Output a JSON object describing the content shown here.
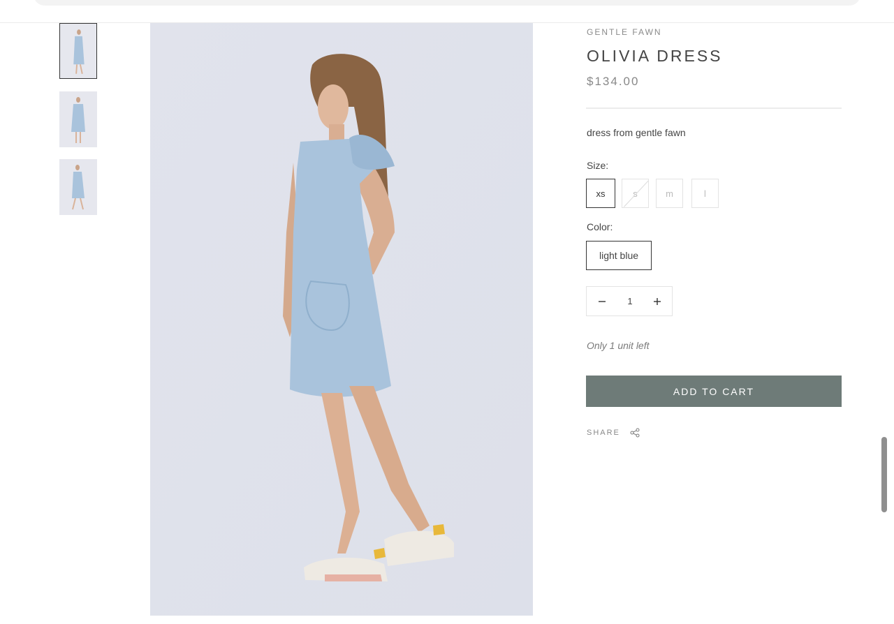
{
  "product": {
    "brand": "GENTLE FAWN",
    "title": "OLIVIA DRESS",
    "price": "$134.00",
    "description": "dress from gentle fawn",
    "size_label": "Size:",
    "sizes": [
      {
        "label": "xs",
        "state": "selected"
      },
      {
        "label": "s",
        "state": "sold-out"
      },
      {
        "label": "m",
        "state": "available"
      },
      {
        "label": "l",
        "state": "available"
      }
    ],
    "color_label": "Color:",
    "color": "light blue",
    "quantity": "1",
    "stock_note": "Only 1 unit left",
    "add_to_cart": "ADD TO CART",
    "share_label": "SHARE"
  },
  "gallery": {
    "thumbnail_count": 3,
    "active_index": 0
  },
  "colors": {
    "button": "#6e7b78",
    "image_background": "#e4e6ee",
    "dress": "#a9c3dc"
  },
  "icons": {
    "minus": "minus-icon",
    "plus": "plus-icon",
    "share": "share-icon"
  }
}
